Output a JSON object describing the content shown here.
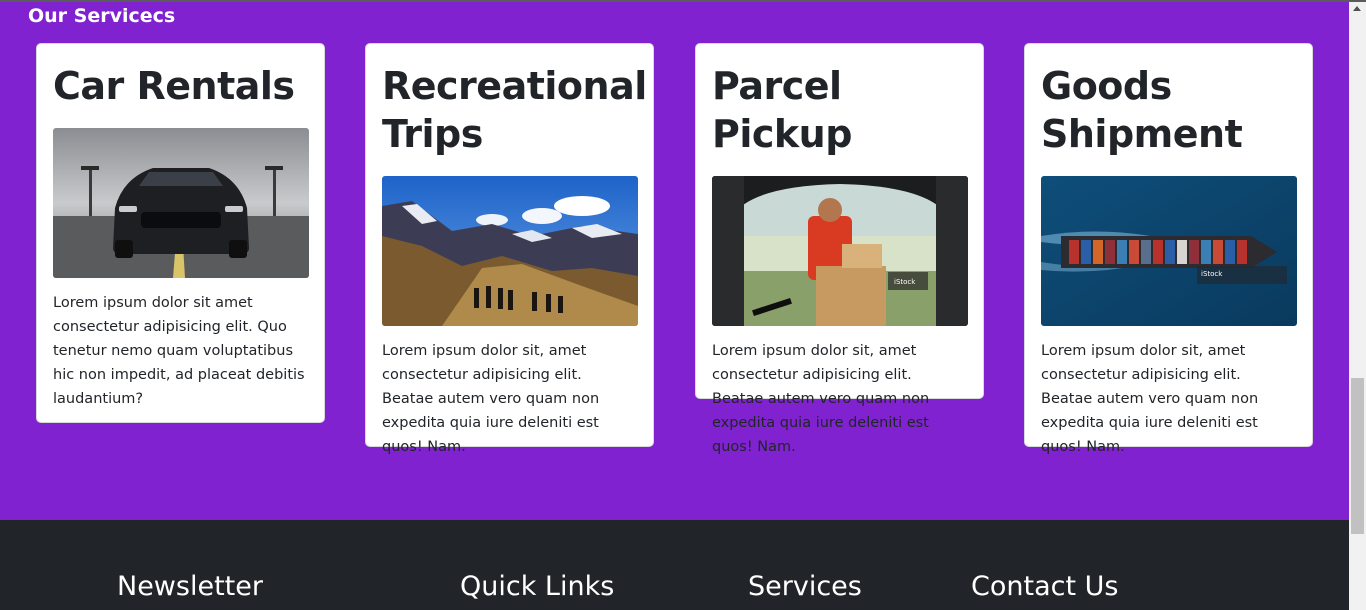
{
  "services": {
    "title": "Our Servicecs",
    "cards": [
      {
        "title": "Car Rentals",
        "image": "black sports car on road",
        "text": "Lorem ipsum dolor sit amet consectetur adipisicing elit. Quo tenetur nemo quam voluptatibus hic non impedit, ad placeat debitis laudantium?"
      },
      {
        "title": "Recreational Trips",
        "image": "hikers on mountain ridge",
        "text": "Lorem ipsum dolor sit, amet consectetur adipisicing elit. Beatae autem vero quam non expedita quia iure deleniti est quos! Nam."
      },
      {
        "title": "Parcel Pickup",
        "image": "courier loading parcel into car trunk",
        "text": "Lorem ipsum dolor sit, amet consectetur adipisicing elit. Beatae autem vero quam non expedita quia iure deleniti est quos! Nam."
      },
      {
        "title": "Goods Shipment",
        "image": "container ship at sea aerial view",
        "text": "Lorem ipsum dolor sit, amet consectetur adipisicing elit. Beatae autem vero quam non expedita quia iure deleniti est quos! Nam."
      }
    ]
  },
  "footer": {
    "headings": [
      "Newsletter",
      "Quick Links",
      "Services",
      "Contact Us"
    ]
  },
  "colors": {
    "section_bg": "#8022d0",
    "footer_bg": "#212529",
    "card_bg": "#ffffff",
    "text": "#212529"
  }
}
